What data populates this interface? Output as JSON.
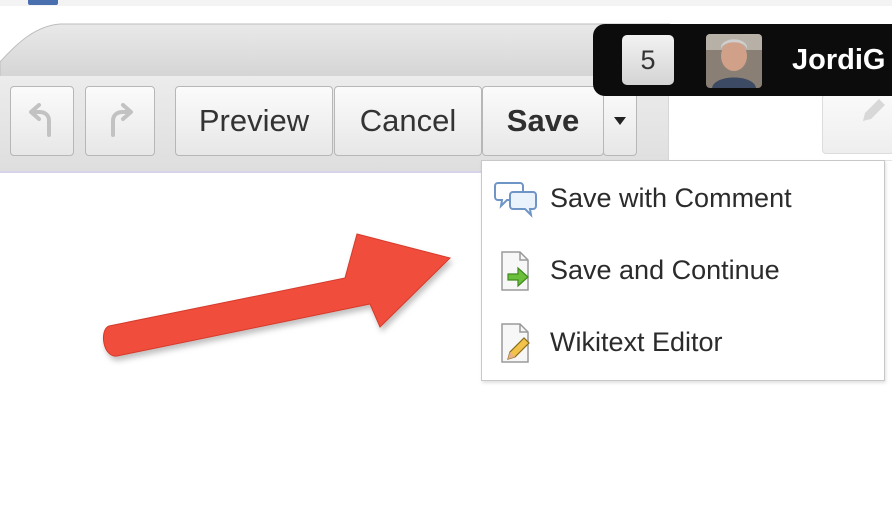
{
  "toolbar": {
    "undo_icon": "undo-icon",
    "redo_icon": "redo-icon",
    "preview_label": "Preview",
    "cancel_label": "Cancel",
    "save_label": "Save",
    "save_dropdown_icon": "caret-down-icon"
  },
  "user_bar": {
    "notification_count": "5",
    "username": "JordiG"
  },
  "save_menu": {
    "items": [
      {
        "label": "Save with Comment",
        "icon": "comment-bubbles-icon"
      },
      {
        "label": "Save and Continue",
        "icon": "document-arrow-icon"
      },
      {
        "label": "Wikitext Editor",
        "icon": "document-pencil-icon"
      }
    ]
  },
  "annotation": {
    "icon": "red-arrow-icon",
    "color": "#f04e3e"
  }
}
